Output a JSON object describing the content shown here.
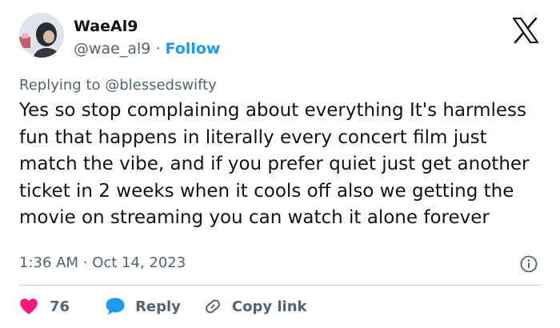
{
  "author": {
    "name": "WaeAl9",
    "handle": "@wae_al9",
    "separator": "·",
    "follow_label": "Follow",
    "avatar_icon": "profile-photo"
  },
  "reply_context": {
    "prefix": "Replying to",
    "user": "@blessedswifty"
  },
  "tweet": {
    "text": "Yes so stop complaining about everything It's harmless fun that happens in literally every concert film just match the vibe, and if you prefer quiet just get another ticket in 2 weeks when it cools off also we getting the movie on streaming you can watch it alone forever",
    "time": "1:36 AM",
    "separator": "·",
    "date": "Oct 14, 2023"
  },
  "actions": {
    "likes": "76",
    "reply_label": "Reply",
    "copy_link_label": "Copy link"
  },
  "icons": {
    "logo": "x-logo-icon",
    "info": "info-icon",
    "like": "heart-icon",
    "reply": "speech-bubble-icon",
    "copy": "link-icon"
  },
  "colors": {
    "text": "#0f1419",
    "muted": "#536471",
    "accent": "#1d9bf0",
    "like": "#f91880",
    "divider": "#cfd9de"
  }
}
